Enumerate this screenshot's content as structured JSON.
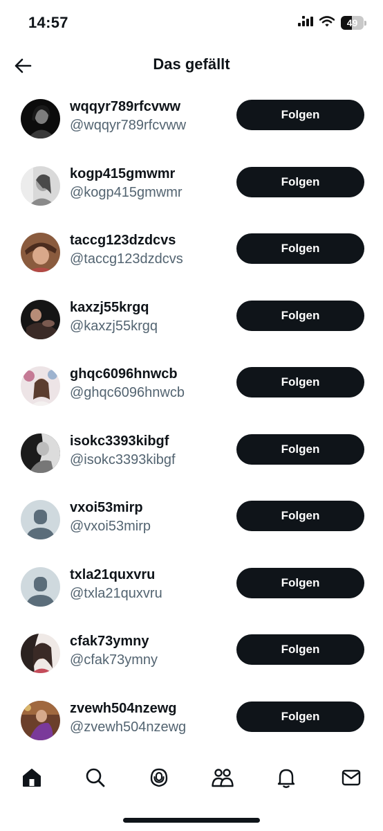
{
  "status_bar": {
    "time": "14:57",
    "battery_level": "49",
    "battery_fraction": 0.49
  },
  "header": {
    "title": "Das gefällt",
    "back_icon": "arrow-left-icon"
  },
  "users": [
    {
      "name": "wqqyr789rfcvww",
      "handle": "@wqqyr789rfcvww",
      "follow_label": "Folgen"
    },
    {
      "name": "kogp415gmwmr",
      "handle": "@kogp415gmwmr",
      "follow_label": "Folgen"
    },
    {
      "name": "taccg123dzdcvs",
      "handle": "@taccg123dzdcvs",
      "follow_label": "Folgen"
    },
    {
      "name": "kaxzj55krgq",
      "handle": "@kaxzj55krgq",
      "follow_label": "Folgen"
    },
    {
      "name": "ghqc6096hnwcb",
      "handle": "@ghqc6096hnwcb",
      "follow_label": "Folgen"
    },
    {
      "name": "isokc3393kibgf",
      "handle": "@isokc3393kibgf",
      "follow_label": "Folgen"
    },
    {
      "name": "vxoi53mirp",
      "handle": "@vxoi53mirp",
      "follow_label": "Folgen"
    },
    {
      "name": "txla21quxvru",
      "handle": "@txla21quxvru",
      "follow_label": "Folgen"
    },
    {
      "name": "cfak73ymny",
      "handle": "@cfak73ymny",
      "follow_label": "Folgen"
    },
    {
      "name": "zvewh504nzewg",
      "handle": "@zvewh504nzewg",
      "follow_label": "Folgen"
    }
  ],
  "bottom_nav": [
    "home-icon",
    "search-icon",
    "spaces-icon",
    "communities-icon",
    "notifications-icon",
    "messages-icon"
  ],
  "colors": {
    "primary_text": "#0f1419",
    "secondary_text": "#536471",
    "button_bg": "#0f1419",
    "button_text": "#ffffff",
    "background": "#ffffff"
  }
}
